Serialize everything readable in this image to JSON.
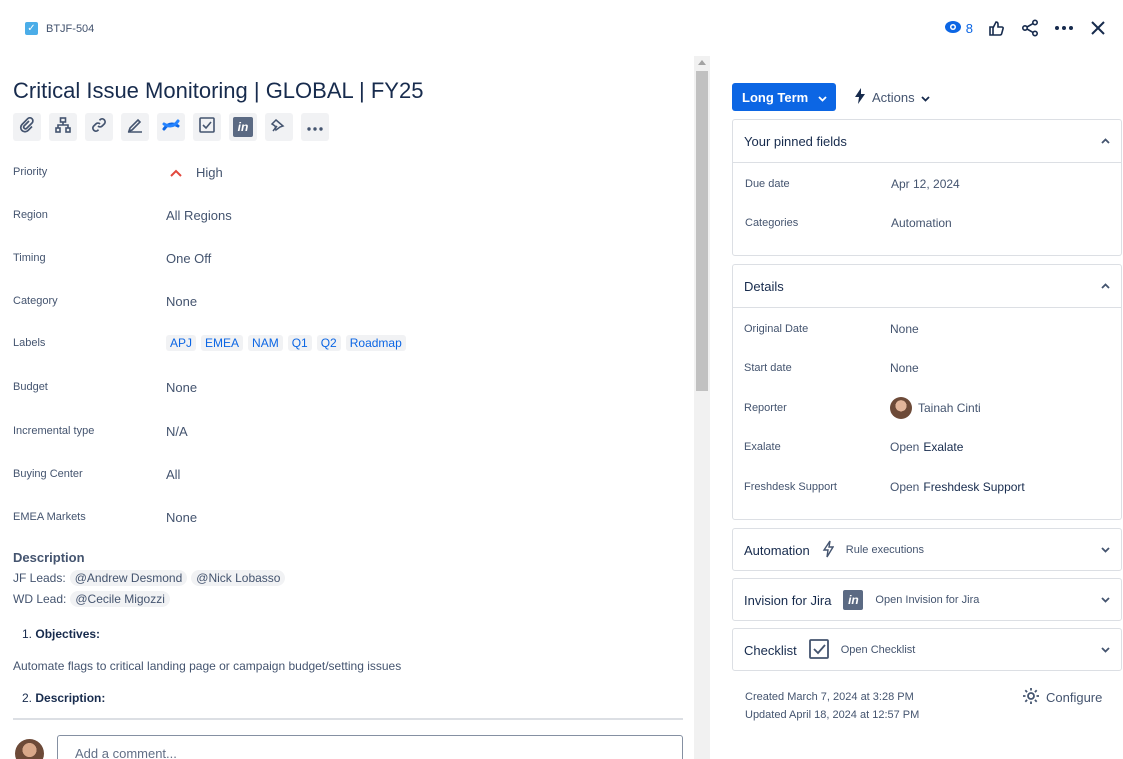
{
  "header": {
    "issue_key": "BTJF-504",
    "watch_count": "8",
    "icons": [
      "eye-icon",
      "thumbs-up-icon",
      "share-icon",
      "more-icon",
      "close-icon"
    ]
  },
  "issue": {
    "title": "Critical Issue Monitoring | GLOBAL | FY25",
    "toolbar_icons": [
      "attachment-icon",
      "child-issues-icon",
      "link-icon",
      "pencil-signature-icon",
      "confluence-icon",
      "checklist-icon",
      "invision-icon",
      "pin-map-icon",
      "more-icon"
    ]
  },
  "fields": [
    {
      "label": "Priority",
      "value": "High"
    },
    {
      "label": "Region",
      "value": "All Regions"
    },
    {
      "label": "Timing",
      "value": "One Off"
    },
    {
      "label": "Category",
      "value": "None"
    },
    {
      "label": "Labels",
      "value": ""
    },
    {
      "label": "Budget",
      "value": "None"
    },
    {
      "label": "Incremental type",
      "value": "N/A"
    },
    {
      "label": "Buying Center",
      "value": "All"
    },
    {
      "label": "EMEA Markets",
      "value": "None"
    }
  ],
  "labels": [
    "APJ",
    "EMEA",
    "NAM",
    "Q1",
    "Q2",
    "Roadmap"
  ],
  "description": {
    "heading": "Description",
    "jf_label": "JF Leads:",
    "jf_mentions": [
      "@Andrew Desmond",
      "@Nick Lobasso"
    ],
    "wd_label": "WD Lead:",
    "wd_mentions": [
      "@Cecile Migozzi"
    ],
    "item1_num": "1.",
    "item1_title": "Objectives:",
    "item1_text": "Automate flags to critical landing page or campaign budget/setting issues",
    "item2_num": "2.",
    "item2_title": "Description:"
  },
  "comment": {
    "placeholder": "Add a comment..."
  },
  "sidebar": {
    "status": "Long Term",
    "actions": "Actions",
    "pinned": {
      "title": "Your pinned fields",
      "rows": [
        {
          "label": "Due date",
          "value": "Apr 12, 2024"
        },
        {
          "label": "Categories",
          "value": "Automation"
        }
      ]
    },
    "details": {
      "title": "Details",
      "original_date_label": "Original Date",
      "original_date_value": "None",
      "start_date_label": "Start date",
      "start_date_value": "None",
      "reporter_label": "Reporter",
      "reporter_value": "Tainah Cinti",
      "exalate_label": "Exalate",
      "exalate_open": "Open",
      "exalate_name": "Exalate",
      "freshdesk_label": "Freshdesk Support",
      "freshdesk_open": "Open",
      "freshdesk_name": "Freshdesk Support"
    },
    "automation": {
      "title": "Automation",
      "sub": "Rule executions"
    },
    "invision": {
      "title": "Invision for Jira",
      "sub": "Open Invision for Jira"
    },
    "checklist": {
      "title": "Checklist",
      "sub": "Open Checklist"
    },
    "created": "Created March 7, 2024 at 3:28 PM",
    "updated": "Updated April 18, 2024 at 12:57 PM",
    "configure": "Configure"
  }
}
